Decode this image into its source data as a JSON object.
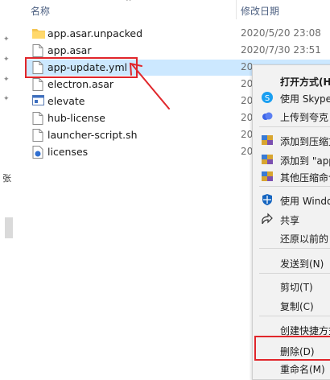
{
  "header": {
    "name_col": "名称",
    "date_col": "修改日期",
    "sort_indicator": "^"
  },
  "sidebar": {
    "truncated_label": "张"
  },
  "files": [
    {
      "name": "app.asar.unpacked",
      "date": "2020/5/20 23:08",
      "icon": "folder-icon",
      "selected": false
    },
    {
      "name": "app.asar",
      "date": "2020/7/30 23:51",
      "icon": "file-icon",
      "selected": false
    },
    {
      "name": "app-update.yml",
      "date": "20",
      "icon": "file-icon",
      "selected": true
    },
    {
      "name": "electron.asar",
      "date": "20",
      "icon": "file-icon",
      "selected": false
    },
    {
      "name": "elevate",
      "date": "20",
      "icon": "app-window-icon",
      "selected": false
    },
    {
      "name": "hub-license",
      "date": "20",
      "icon": "file-icon",
      "selected": false
    },
    {
      "name": "launcher-script.sh",
      "date": "20",
      "icon": "file-icon",
      "selected": false
    },
    {
      "name": "licenses",
      "date": "20",
      "icon": "html-file-icon",
      "selected": false
    }
  ],
  "context_menu": {
    "items": [
      {
        "label": "打开方式(H",
        "icon": "",
        "bold": true
      },
      {
        "label": "使用 Skype",
        "icon": "skype-icon"
      },
      {
        "label": "上传到夸克",
        "icon": "cloud-upload-icon"
      },
      {
        "label": "添加到压缩文",
        "icon": "archive-icon"
      },
      {
        "label": "添加到 \"app",
        "icon": "archive-icon"
      },
      {
        "label": "其他压缩命令",
        "icon": "archive-icon"
      },
      {
        "label": "使用 Windo",
        "icon": "defender-shield-icon"
      },
      {
        "label": "共享",
        "icon": "share-icon"
      },
      {
        "label": "还原以前的",
        "icon": ""
      },
      {
        "label": "发送到(N)",
        "icon": ""
      },
      {
        "label": "剪切(T)",
        "icon": ""
      },
      {
        "label": "复制(C)",
        "icon": ""
      },
      {
        "label": "创建快捷方式",
        "icon": ""
      },
      {
        "label": "删除(D)",
        "icon": ""
      },
      {
        "label": "重命名(M)",
        "icon": ""
      }
    ]
  },
  "colors": {
    "selection": "#cce8ff",
    "annotation_red": "#e0262b",
    "header_text": "#4d6082",
    "menu_bg": "#f2f2f2"
  }
}
